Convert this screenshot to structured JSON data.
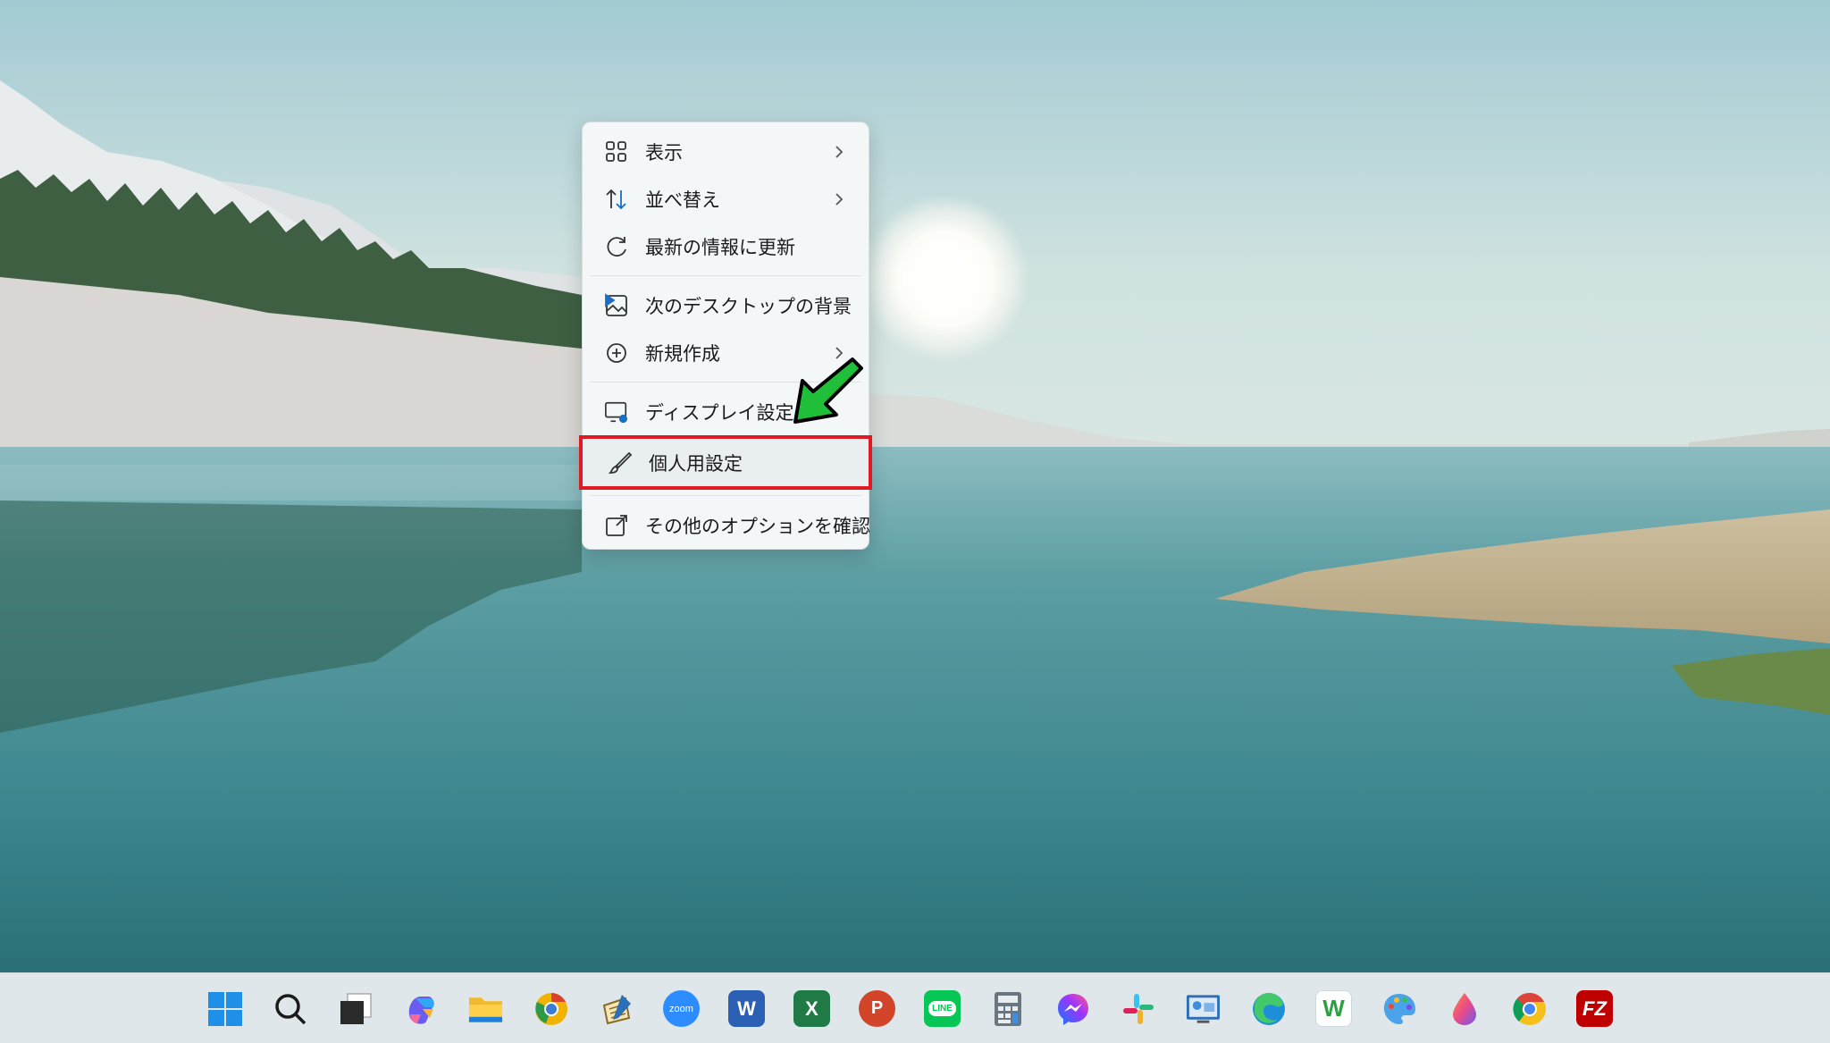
{
  "context_menu": {
    "items": [
      {
        "label": "表示",
        "icon": "view-grid-icon",
        "submenu": true
      },
      {
        "label": "並べ替え",
        "icon": "sort-icon",
        "submenu": true
      },
      {
        "label": "最新の情報に更新",
        "icon": "refresh-icon",
        "submenu": false
      },
      {
        "label": "次のデスクトップの背景",
        "icon": "next-background-icon",
        "submenu": false
      },
      {
        "label": "新規作成",
        "icon": "new-plus-icon",
        "submenu": true
      },
      {
        "label": "ディスプレイ設定",
        "icon": "display-settings-icon",
        "submenu": false
      },
      {
        "label": "個人用設定",
        "icon": "brush-icon",
        "submenu": false,
        "highlighted": true
      },
      {
        "label": "その他のオプションを確認",
        "icon": "more-options-icon",
        "submenu": false
      }
    ]
  },
  "annotation": {
    "highlight_color": "#e01a22",
    "arrow_color": "#1fbf3a"
  },
  "taskbar": {
    "icons": [
      {
        "name": "start-icon",
        "text": ""
      },
      {
        "name": "search-icon",
        "text": ""
      },
      {
        "name": "task-view-icon",
        "text": ""
      },
      {
        "name": "copilot-icon",
        "text": ""
      },
      {
        "name": "file-explorer-icon",
        "text": ""
      },
      {
        "name": "chrome-canary-icon",
        "text": ""
      },
      {
        "name": "notes-app-icon",
        "text": ""
      },
      {
        "name": "zoom-icon",
        "text": "zoom"
      },
      {
        "name": "word-icon",
        "text": "W"
      },
      {
        "name": "excel-icon",
        "text": "X"
      },
      {
        "name": "powerpoint-icon",
        "text": "P"
      },
      {
        "name": "line-icon",
        "text": "LINE"
      },
      {
        "name": "calculator-icon",
        "text": ""
      },
      {
        "name": "messenger-icon",
        "text": ""
      },
      {
        "name": "slack-icon",
        "text": ""
      },
      {
        "name": "remote-desktop-icon",
        "text": ""
      },
      {
        "name": "edge-icon",
        "text": ""
      },
      {
        "name": "w-app-icon",
        "text": "W"
      },
      {
        "name": "paint-icon",
        "text": ""
      },
      {
        "name": "drop-app-icon",
        "text": ""
      },
      {
        "name": "chrome-icon",
        "text": ""
      },
      {
        "name": "filezilla-icon",
        "text": "FZ"
      }
    ]
  }
}
